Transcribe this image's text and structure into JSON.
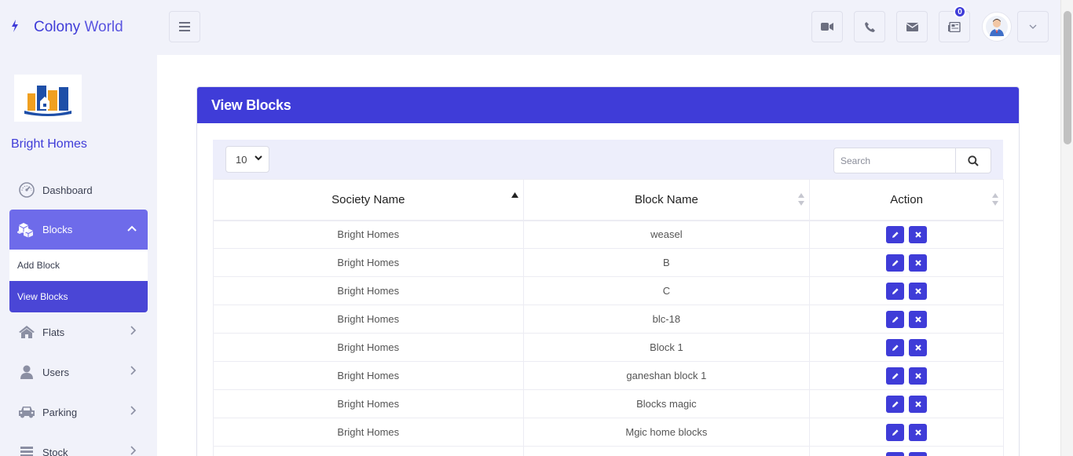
{
  "brand": {
    "name_part1": "Colony",
    "name_part2": "World"
  },
  "header": {
    "notification_count": "0"
  },
  "sidebar": {
    "society_name": "Bright Homes",
    "items": [
      {
        "label": "Dashboard",
        "icon": "dashboard-icon"
      },
      {
        "label": "Blocks",
        "icon": "cubes-icon"
      },
      {
        "label": "Flats",
        "icon": "home-icon"
      },
      {
        "label": "Users",
        "icon": "user-icon"
      },
      {
        "label": "Parking",
        "icon": "car-icon"
      },
      {
        "label": "Stock",
        "icon": "stock-icon"
      }
    ],
    "blocks_sub": {
      "add": "Add Block",
      "view": "View Blocks"
    }
  },
  "card": {
    "title": "View Blocks"
  },
  "table_tools": {
    "page_length": "10",
    "search_placeholder": "Search"
  },
  "table": {
    "headers": [
      "Society Name",
      "Block Name",
      "Action"
    ],
    "rows": [
      {
        "society": "Bright Homes",
        "block": "weasel"
      },
      {
        "society": "Bright Homes",
        "block": "B"
      },
      {
        "society": "Bright Homes",
        "block": "C"
      },
      {
        "society": "Bright Homes",
        "block": "blc-18"
      },
      {
        "society": "Bright Homes",
        "block": "Block 1"
      },
      {
        "society": "Bright Homes",
        "block": "ganeshan block 1"
      },
      {
        "society": "Bright Homes",
        "block": "Blocks magic"
      },
      {
        "society": "Bright Homes",
        "block": "Mgic home blocks"
      },
      {
        "society": "",
        "block": ""
      }
    ]
  },
  "colors": {
    "accent": "#3f3cd8",
    "active_nav": "#6e6bea",
    "background": "#f1f2fa"
  }
}
